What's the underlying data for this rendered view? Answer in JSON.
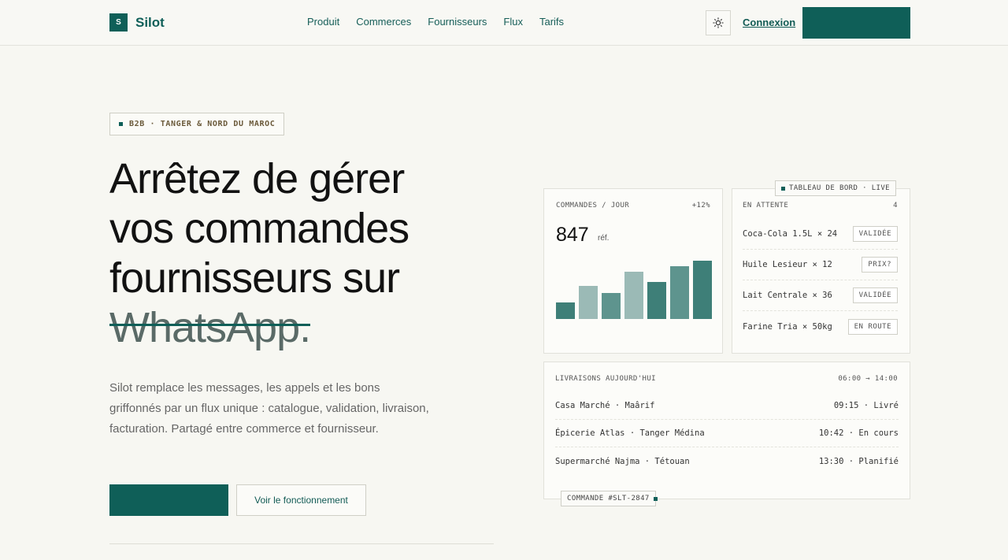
{
  "header": {
    "logo_mark": "S",
    "logo_text": "Silot",
    "nav": [
      "Produit",
      "Commerces",
      "Fournisseurs",
      "Flux",
      "Tarifs"
    ],
    "theme_icon": "sun-icon",
    "login": "Connexion"
  },
  "hero": {
    "tag": "B2B · TANGER & NORD DU MAROC",
    "headline_line1": "Arrêtez de gérer",
    "headline_line2": "vos commandes",
    "headline_line3": "fournisseurs sur",
    "headline_strike": "WhatsApp.",
    "description": "Silot remplace les messages, les appels et les bons griffonnés par un flux unique : catalogue, validation, livraison, facturation. Partagé entre commerce et fournisseur.",
    "secondary_cta": "Voir le fonctionnement"
  },
  "dashboard": {
    "live_tag": "TABLEAU DE BORD · LIVE",
    "orders": {
      "label": "COMMANDES / JOUR",
      "delta": "+12%",
      "value": "847",
      "unit": "réf.",
      "bars": [
        0.29,
        0.57,
        0.44,
        0.81,
        0.63,
        0.9,
        1.0
      ],
      "bar_colors": [
        "#3e7f78",
        "#9bbab6",
        "#5e948e",
        "#9bbab6",
        "#3e7f78",
        "#5e948e",
        "#3e7f78"
      ]
    },
    "pending": {
      "label": "EN ATTENTE",
      "count": "4",
      "items": [
        {
          "name": "Coca-Cola 1.5L × 24",
          "status": "VALIDÉE"
        },
        {
          "name": "Huile Lesieur × 12",
          "status": "PRIX?"
        },
        {
          "name": "Lait Centrale × 36",
          "status": "VALIDÉE"
        },
        {
          "name": "Farine Tria × 50kg",
          "status": "EN ROUTE"
        }
      ]
    },
    "deliveries": {
      "label": "LIVRAISONS AUJOURD'HUI",
      "window": "06:00 → 14:00",
      "items": [
        {
          "name": "Casa Marché · Maârif",
          "status": "09:15 · Livré"
        },
        {
          "name": "Épicerie Atlas · Tanger Médina",
          "status": "10:42 · En cours"
        },
        {
          "name": "Supermarché Najma · Tétouan",
          "status": "13:30 · Planifié"
        }
      ]
    },
    "order_tag": "COMMANDE #SLT-2847"
  },
  "colors": {
    "brand": "#0f5f58",
    "background": "#f7f7f2"
  }
}
